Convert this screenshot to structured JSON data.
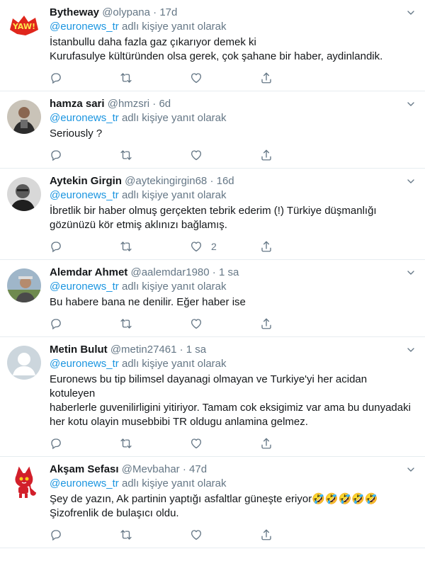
{
  "reply_prefix_after": "adlı kişiye yanıt olarak",
  "tweets": [
    {
      "name": "Bytheway",
      "handle": "@olypana",
      "sep": "·",
      "time": "17d",
      "mention": "@euronews_tr",
      "text": "İstanbullu daha fazla gaz çıkarıyor demek ki\nKurufasulye kültüründen olsa gerek, çok şahane bir haber, aydinlandik.",
      "likes": "",
      "avatar": "yaw-logo"
    },
    {
      "name": "hamza sari",
      "handle": "@hmzsri",
      "sep": "·",
      "time": "6d",
      "mention": "@euronews_tr",
      "text": "Seriously ?",
      "likes": "",
      "avatar": "photo-person"
    },
    {
      "name": "Aytekin Girgin",
      "handle": "@aytekingirgin68",
      "sep": "·",
      "time": "16d",
      "mention": "@euronews_tr",
      "text": "İbretlik bir haber olmuş gerçekten tebrik ederim (!) Türkiye düşmanlığı\ngözünüzü kör etmiş aklınızı bağlamış.",
      "likes": "2",
      "avatar": "photo-bw"
    },
    {
      "name": "Alemdar Ahmet",
      "handle": "@aalemdar1980",
      "sep": "·",
      "time": "1 sa",
      "mention": "@euronews_tr",
      "text": "Bu habere bana ne denilir. Eğer haber ise",
      "likes": "",
      "avatar": "photo-outdoor"
    },
    {
      "name": "Metin Bulut",
      "handle": "@metin27461",
      "sep": "·",
      "time": "1 sa",
      "mention": "@euronews_tr",
      "text": "Euronews bu tip bilimsel dayanagi olmayan ve Turkiye'yi her acidan kotuleyen\nhaberlerle guvenilirligini yitiriyor. Tamam cok eksigimiz var ama bu dunyadaki\nher kotu olayin musebbibi TR oldugu anlamina gelmez.",
      "likes": "",
      "avatar": "default-person"
    },
    {
      "name": "Akşam Sefası",
      "handle": "@Mevbahar",
      "sep": "·",
      "time": "47d",
      "mention": "@euronews_tr",
      "text": "Şey de yazın, Ak partinin yaptığı asfaltlar güneşte eriyor🤣🤣🤣🤣🤣\nŞizofrenlik de bulaşıcı oldu.",
      "likes": "",
      "avatar": "red-cat"
    }
  ],
  "colors": {
    "accent": "#1b95e0",
    "muted": "#657786",
    "text": "#14171a",
    "divider": "#e6ecf0"
  },
  "icons": [
    "reply-icon",
    "retweet-icon",
    "like-icon",
    "share-icon",
    "chevron-down-icon"
  ]
}
